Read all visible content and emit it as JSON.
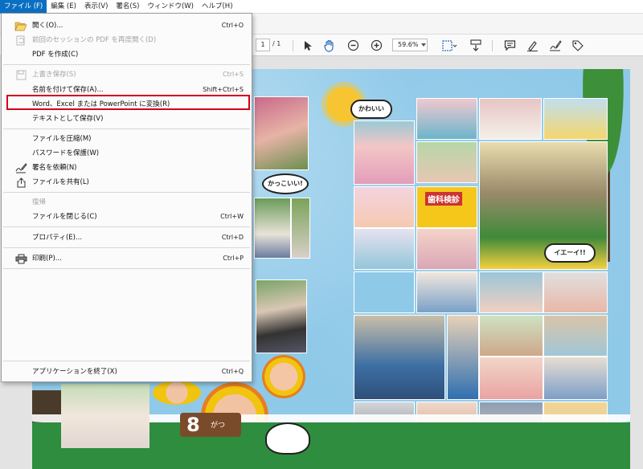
{
  "menubar": {
    "items": [
      "ファイル (F)",
      "編集 (E)",
      "表示(V)",
      "署名(S)",
      "ウィンドウ(W)",
      "ヘルプ(H)"
    ]
  },
  "toolbar": {
    "page_current": "1",
    "page_total": "/ 1",
    "zoom": "59.6%"
  },
  "file_menu": {
    "items": [
      {
        "label": "開く(O)...",
        "shortcut": "Ctrl+O",
        "icon": "folder-open-icon",
        "disabled": false
      },
      {
        "label": "前回のセッションの PDF を再度開く(D)",
        "shortcut": "",
        "icon": "reopen-icon",
        "disabled": true
      },
      {
        "label": "PDF を作成(C)",
        "shortcut": "",
        "icon": "",
        "disabled": false
      },
      {
        "label": "上書き保存(S)",
        "shortcut": "Ctrl+S",
        "icon": "save-icon",
        "disabled": true
      },
      {
        "label": "名前を付けて保存(A)...",
        "shortcut": "Shift+Ctrl+S",
        "icon": "",
        "disabled": false
      },
      {
        "label": "Word、Excel または PowerPoint に変換(R)",
        "shortcut": "",
        "icon": "",
        "disabled": false
      },
      {
        "label": "テキストとして保存(V)",
        "shortcut": "",
        "icon": "",
        "disabled": false
      },
      {
        "label": "ファイルを圧縮(M)",
        "shortcut": "",
        "icon": "",
        "disabled": false
      },
      {
        "label": "パスワードを保護(W)",
        "shortcut": "",
        "icon": "",
        "disabled": false
      },
      {
        "label": "署名を依頼(N)",
        "shortcut": "",
        "icon": "sign-pen-icon",
        "disabled": false
      },
      {
        "label": "ファイルを共有(L)",
        "shortcut": "",
        "icon": "share-icon",
        "disabled": false
      },
      {
        "label": "復帰",
        "shortcut": "",
        "icon": "",
        "disabled": true
      },
      {
        "label": "ファイルを閉じる(C)",
        "shortcut": "Ctrl+W",
        "icon": "",
        "disabled": false
      },
      {
        "label": "プロパティ(E)...",
        "shortcut": "Ctrl+D",
        "icon": "",
        "disabled": false
      },
      {
        "label": "印刷(P)...",
        "shortcut": "Ctrl+P",
        "icon": "printer-icon",
        "disabled": false
      },
      {
        "label": "アプリケーションを終了(X)",
        "shortcut": "Ctrl+Q",
        "icon": "",
        "disabled": false
      }
    ]
  },
  "document": {
    "bubble_kawaii": "かわいい",
    "bubble_kakkoii": "かっこいい!",
    "bubble_yay": "イエーイ!!",
    "sign_dental": "歯科検診",
    "month_label": "がつ",
    "month_number": "8"
  },
  "colors": {
    "menu_active": "#0a6fc2",
    "highlight": "#d0021b",
    "grass": "#2e8d3f",
    "sky": "#8fc9e8"
  }
}
